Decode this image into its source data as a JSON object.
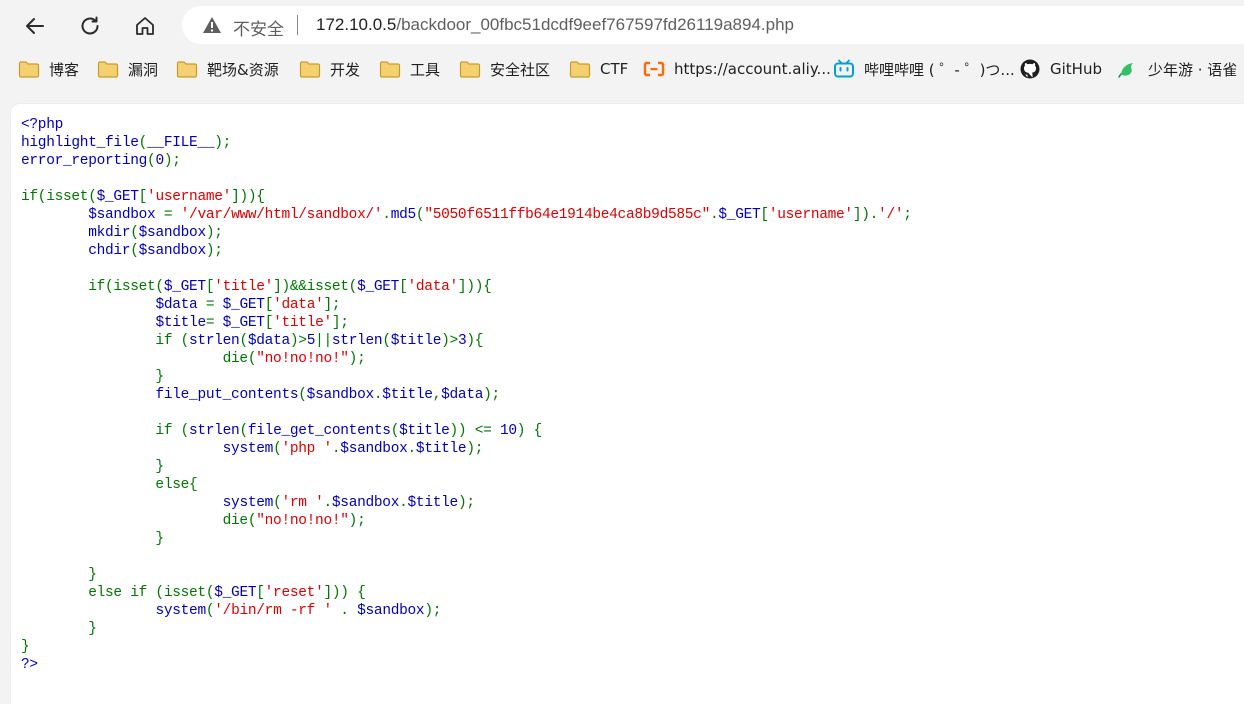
{
  "browser": {
    "security_label": "不安全",
    "url_host": "172.10.0.5",
    "url_path": "/backdoor_00fbc51dcdf9eef767597fd26119a894.php"
  },
  "bookmarks": [
    {
      "label": "博客",
      "icon": "folder-icon"
    },
    {
      "label": "漏洞",
      "icon": "folder-icon"
    },
    {
      "label": "靶场&资源",
      "icon": "folder-icon"
    },
    {
      "label": "开发",
      "icon": "folder-icon"
    },
    {
      "label": "工具",
      "icon": "folder-icon"
    },
    {
      "label": "安全社区",
      "icon": "folder-icon"
    },
    {
      "label": "CTF",
      "icon": "folder-icon"
    },
    {
      "label": "https://account.aliy...",
      "icon": "aliyun-icon"
    },
    {
      "label": "哔哩哔哩 ( ゜- ゜)つ...",
      "icon": "bilibili-icon"
    },
    {
      "label": "GitHub",
      "icon": "github-icon"
    },
    {
      "label": "少年游 · 语雀",
      "icon": "yuque-icon"
    }
  ],
  "colors": {
    "php_default": "#0000bb",
    "php_keyword": "#007700",
    "php_string": "#dd0000",
    "folder": "#f2c24b"
  },
  "code_lines": [
    [
      [
        "d",
        "<?php"
      ]
    ],
    [
      [
        "d",
        "highlight_file"
      ],
      [
        "k",
        "("
      ],
      [
        "d",
        "__FILE__"
      ],
      [
        "k",
        ");"
      ]
    ],
    [
      [
        "d",
        "error_reporting"
      ],
      [
        "k",
        "("
      ],
      [
        "d",
        "0"
      ],
      [
        "k",
        ");"
      ]
    ],
    [],
    [
      [
        "k",
        "if(isset("
      ],
      [
        "d",
        "$_GET"
      ],
      [
        "k",
        "["
      ],
      [
        "s",
        "'username'"
      ],
      [
        "k",
        "])){"
      ]
    ],
    [
      [
        "k",
        "        "
      ],
      [
        "d",
        "$sandbox "
      ],
      [
        "k",
        "= "
      ],
      [
        "s",
        "'/var/www/html/sandbox/'"
      ],
      [
        "k",
        "."
      ],
      [
        "d",
        "md5"
      ],
      [
        "k",
        "("
      ],
      [
        "s",
        "\"5050f6511ffb64e1914be4ca8b9d585c\""
      ],
      [
        "k",
        "."
      ],
      [
        "d",
        "$_GET"
      ],
      [
        "k",
        "["
      ],
      [
        "s",
        "'username'"
      ],
      [
        "k",
        "])."
      ],
      [
        "s",
        "'/'"
      ],
      [
        "k",
        ";"
      ]
    ],
    [
      [
        "k",
        "        "
      ],
      [
        "d",
        "mkdir"
      ],
      [
        "k",
        "("
      ],
      [
        "d",
        "$sandbox"
      ],
      [
        "k",
        ");"
      ]
    ],
    [
      [
        "k",
        "        "
      ],
      [
        "d",
        "chdir"
      ],
      [
        "k",
        "("
      ],
      [
        "d",
        "$sandbox"
      ],
      [
        "k",
        ");"
      ]
    ],
    [],
    [
      [
        "k",
        "        if(isset("
      ],
      [
        "d",
        "$_GET"
      ],
      [
        "k",
        "["
      ],
      [
        "s",
        "'title'"
      ],
      [
        "k",
        "])&&isset("
      ],
      [
        "d",
        "$_GET"
      ],
      [
        "k",
        "["
      ],
      [
        "s",
        "'data'"
      ],
      [
        "k",
        "])){"
      ]
    ],
    [
      [
        "k",
        "                "
      ],
      [
        "d",
        "$data "
      ],
      [
        "k",
        "= "
      ],
      [
        "d",
        "$_GET"
      ],
      [
        "k",
        "["
      ],
      [
        "s",
        "'data'"
      ],
      [
        "k",
        "];"
      ]
    ],
    [
      [
        "k",
        "                "
      ],
      [
        "d",
        "$title"
      ],
      [
        "k",
        "= "
      ],
      [
        "d",
        "$_GET"
      ],
      [
        "k",
        "["
      ],
      [
        "s",
        "'title'"
      ],
      [
        "k",
        "];"
      ]
    ],
    [
      [
        "k",
        "                if ("
      ],
      [
        "d",
        "strlen"
      ],
      [
        "k",
        "("
      ],
      [
        "d",
        "$data"
      ],
      [
        "k",
        ")>"
      ],
      [
        "d",
        "5"
      ],
      [
        "k",
        "||"
      ],
      [
        "d",
        "strlen"
      ],
      [
        "k",
        "("
      ],
      [
        "d",
        "$title"
      ],
      [
        "k",
        ")>"
      ],
      [
        "d",
        "3"
      ],
      [
        "k",
        "){"
      ]
    ],
    [
      [
        "k",
        "                        die("
      ],
      [
        "s",
        "\"no!no!no!\""
      ],
      [
        "k",
        ");"
      ]
    ],
    [
      [
        "k",
        "                }"
      ]
    ],
    [
      [
        "k",
        "                "
      ],
      [
        "d",
        "file_put_contents"
      ],
      [
        "k",
        "("
      ],
      [
        "d",
        "$sandbox"
      ],
      [
        "k",
        "."
      ],
      [
        "d",
        "$title"
      ],
      [
        "k",
        ","
      ],
      [
        "d",
        "$data"
      ],
      [
        "k",
        ");"
      ]
    ],
    [],
    [
      [
        "k",
        "                if ("
      ],
      [
        "d",
        "strlen"
      ],
      [
        "k",
        "("
      ],
      [
        "d",
        "file_get_contents"
      ],
      [
        "k",
        "("
      ],
      [
        "d",
        "$title"
      ],
      [
        "k",
        ")) <= "
      ],
      [
        "d",
        "10"
      ],
      [
        "k",
        ") {"
      ]
    ],
    [
      [
        "k",
        "                        "
      ],
      [
        "d",
        "system"
      ],
      [
        "k",
        "("
      ],
      [
        "s",
        "'php '"
      ],
      [
        "k",
        "."
      ],
      [
        "d",
        "$sandbox"
      ],
      [
        "k",
        "."
      ],
      [
        "d",
        "$title"
      ],
      [
        "k",
        ");"
      ]
    ],
    [
      [
        "k",
        "                }"
      ]
    ],
    [
      [
        "k",
        "                else{"
      ]
    ],
    [
      [
        "k",
        "                        "
      ],
      [
        "d",
        "system"
      ],
      [
        "k",
        "("
      ],
      [
        "s",
        "'rm '"
      ],
      [
        "k",
        "."
      ],
      [
        "d",
        "$sandbox"
      ],
      [
        "k",
        "."
      ],
      [
        "d",
        "$title"
      ],
      [
        "k",
        ");"
      ]
    ],
    [
      [
        "k",
        "                        die("
      ],
      [
        "s",
        "\"no!no!no!\""
      ],
      [
        "k",
        ");"
      ]
    ],
    [
      [
        "k",
        "                }"
      ]
    ],
    [],
    [
      [
        "k",
        "        }"
      ]
    ],
    [
      [
        "k",
        "        else if (isset("
      ],
      [
        "d",
        "$_GET"
      ],
      [
        "k",
        "["
      ],
      [
        "s",
        "'reset'"
      ],
      [
        "k",
        "])) {"
      ]
    ],
    [
      [
        "k",
        "                "
      ],
      [
        "d",
        "system"
      ],
      [
        "k",
        "("
      ],
      [
        "s",
        "'/bin/rm -rf ' "
      ],
      [
        "k",
        ". "
      ],
      [
        "d",
        "$sandbox"
      ],
      [
        "k",
        ");"
      ]
    ],
    [
      [
        "k",
        "        }"
      ]
    ],
    [
      [
        "k",
        "}"
      ]
    ],
    [
      [
        "d",
        "?>"
      ]
    ]
  ]
}
